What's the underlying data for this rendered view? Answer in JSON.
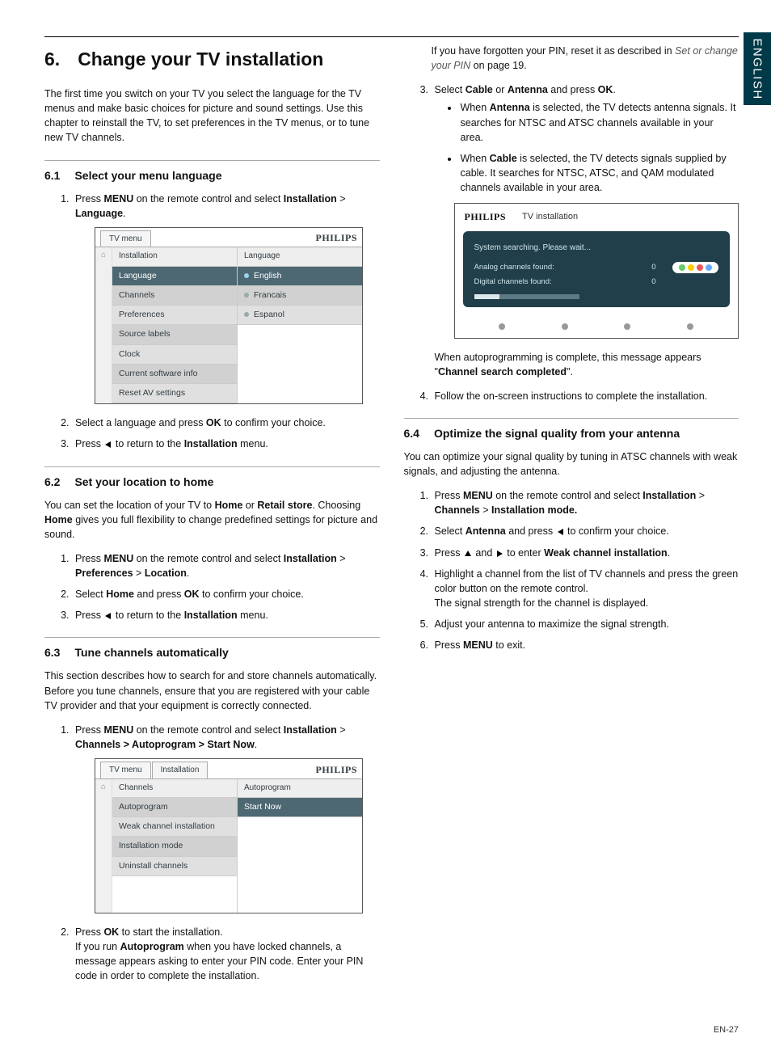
{
  "lang_tab": "ENGLISH",
  "chapter": {
    "num": "6.",
    "title": "Change your TV installation"
  },
  "intro": "The first time you switch on your TV you select the language for the TV menus and make basic choices for picture and sound settings.  Use this chapter to reinstall the TV, to set preferences in the TV menus, or to tune new TV channels.",
  "s61": {
    "num": "6.1",
    "title": "Select your menu language",
    "step1a": "Press ",
    "step1b": " on the remote control and select ",
    "step1c": " > ",
    "menu": "MENU",
    "installation": "Installation",
    "language": "Language",
    "box": {
      "tab": "TV menu",
      "brand": "PHILIPS",
      "left_title": "Installation",
      "left": [
        "Language",
        "Channels",
        "Preferences",
        "Source labels",
        "Clock",
        "Current software info",
        "Reset AV settings"
      ],
      "right_title": "Language",
      "right": [
        "English",
        "Francais",
        "Espanol"
      ]
    },
    "step2a": "Select a language and press ",
    "ok": "OK",
    "step2b": " to confirm your choice.",
    "step3a": "Press ",
    "step3b": " to return to the ",
    "step3c": " menu."
  },
  "s62": {
    "num": "6.2",
    "title": "Set your location to home",
    "p1a": "You can set the location of your TV to ",
    "home": "Home",
    "p1b": " or ",
    "retail": "Retail store",
    "p1c": ". Choosing ",
    "p1d": " gives you full flexibility to change predefined settings for picture and sound.",
    "step1a": "Press ",
    "menu": "MENU",
    "step1b": " on the remote control and select ",
    "installation": "Installation",
    "gt": " > ",
    "preferences": "Preferences",
    "location": "Location",
    "step2a": "Select ",
    "step2b": " and press ",
    "ok": "OK",
    "step2c": " to confirm your choice.",
    "step3a": "Press ",
    "step3b": " to return to the ",
    "step3c": " menu."
  },
  "s63": {
    "num": "6.3",
    "title": "Tune channels automatically",
    "p1": "This section describes how to search for and store channels automatically.  Before you tune channels, ensure that you are registered with your cable TV provider and that your equipment is correctly connected.",
    "step1a": "Press ",
    "menu": "MENU",
    "step1b": " on the remote control and select ",
    "installation": "Installation",
    "gt": " > ",
    "path": "Channels > Autoprogram > Start Now",
    "box": {
      "tab1": "TV menu",
      "tab2": "Installation",
      "brand": "PHILIPS",
      "left_title": "Channels",
      "left": [
        "Autoprogram",
        "Weak channel installation",
        "Installation mode",
        "Uninstall channels"
      ],
      "right_title": "Autoprogram",
      "right": [
        "Start Now"
      ]
    },
    "step2a": "Press ",
    "ok": "OK",
    "step2b": " to start the installation.",
    "step2c": "If you run ",
    "auto": "Autoprogram",
    "step2d": " when you have locked channels, a message appears asking to enter your PIN code.  Enter your PIN code in order to complete the installation."
  },
  "rcol": {
    "pin1": "If you have forgotten your PIN, reset it as described in ",
    "pin_link": "Set or change your PIN",
    "pin2": " on page 19.",
    "step3a": "Select ",
    "cable": "Cable",
    "or": " or ",
    "antenna": "Antenna",
    "step3b": " and press ",
    "ok": "OK",
    "b1a": "When ",
    "b1b": " is selected, the TV detects antenna signals.  It searches for NTSC and ATSC channels available in your area.",
    "b2b": " is selected, the TV detects signals supplied by cable.  It searches for NTSC, ATSC, and QAM modulated channels available in your area.",
    "search_box": {
      "brand": "PHILIPS",
      "title": "TV installation",
      "line1": "System searching.  Please wait...",
      "analog_l": "Analog channels found:",
      "analog_v": "0",
      "digital_l": "Digital channels found:",
      "digital_v": "0"
    },
    "after1": "When autoprogramming is complete, this message appears \"",
    "after_bold": "Channel search completed",
    "after2": "\".",
    "step4": "Follow the on-screen instructions to complete the installation."
  },
  "s64": {
    "num": "6.4",
    "title": "Optimize the signal quality from your antenna",
    "p1": "You can optimize your signal quality by tuning in ATSC channels with weak signals, and adjusting the antenna.",
    "step1a": "Press ",
    "menu": "MENU",
    "step1b": " on the remote control and select ",
    "installation": "Installation",
    "gt": " > ",
    "channels": "Channels",
    "imode": "Installation mode.",
    "step2a": "Select ",
    "antenna": "Antenna",
    "step2b": " and press ",
    "step2c": " to confirm your choice.",
    "step3a": "Press ",
    "step3b": " and ",
    "step3c": " to enter ",
    "weak": "Weak channel installation",
    "step4": "Highlight a channel from the list of TV channels and press the green color button on the remote control.",
    "step4b": "The signal strength for the channel is displayed.",
    "step5": "Adjust your antenna to maximize the signal strength.",
    "step6a": "Press ",
    "step6b": " to exit."
  },
  "page_num": "EN-27"
}
